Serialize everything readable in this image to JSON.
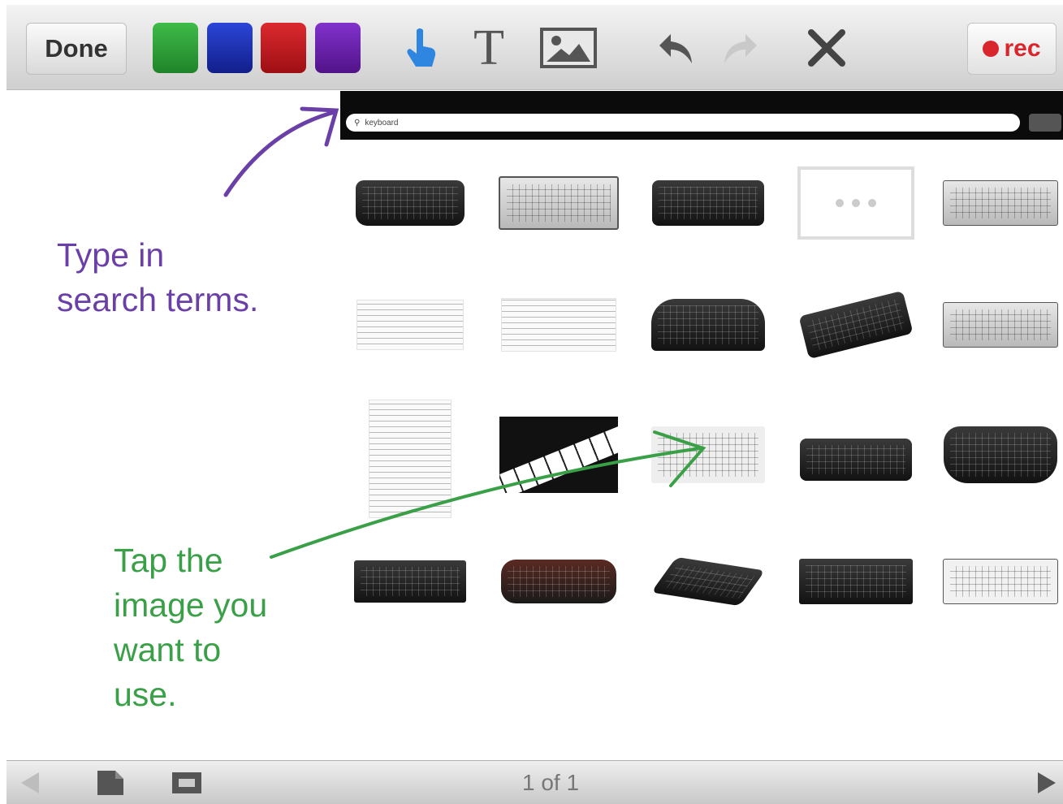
{
  "toolbar": {
    "done_label": "Done",
    "colors": [
      {
        "name": "green",
        "hex": "#2e9a37"
      },
      {
        "name": "blue",
        "hex": "#1c2fb8"
      },
      {
        "name": "red",
        "hex": "#c8161d"
      },
      {
        "name": "purple",
        "hex": "#6b1cb0"
      }
    ],
    "tools": [
      "pointer-hand-icon",
      "text-tool-icon",
      "image-tool-icon",
      "undo-icon",
      "redo-icon",
      "close-icon"
    ],
    "rec_label": "rec"
  },
  "embedded_screen": {
    "search_value": "keyboard"
  },
  "annotations": {
    "purple_lines": [
      "Type in",
      "search terms."
    ],
    "green_lines": [
      "Tap the",
      "image you",
      "want to",
      "use."
    ]
  },
  "bottom_bar": {
    "page_label": "1 of 1"
  },
  "accent_colors": {
    "purple_ink": "#6a3fa8",
    "green_ink": "#3aa048",
    "rec_red": "#d8262c"
  }
}
